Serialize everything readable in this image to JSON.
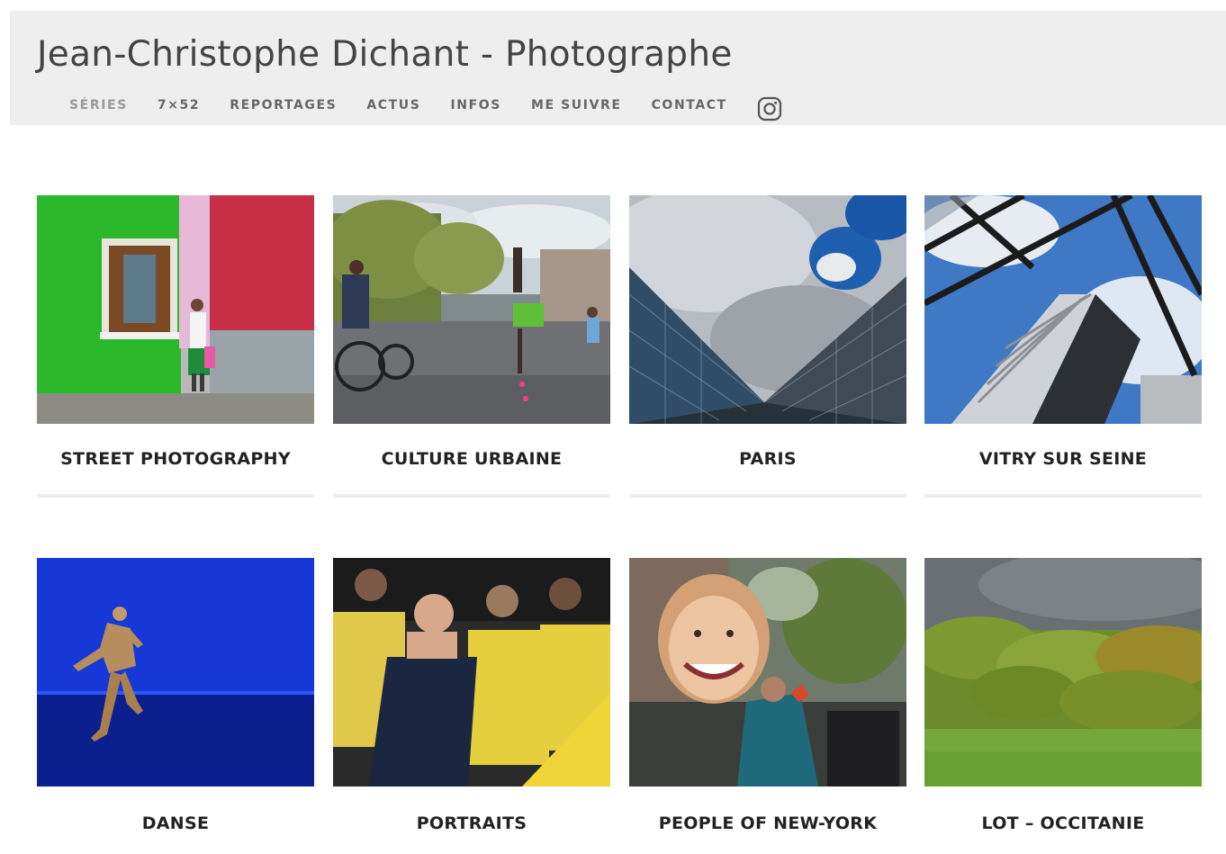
{
  "site": {
    "title": "Jean-Christophe Dichant - Photographe"
  },
  "nav": {
    "items": [
      {
        "label": "SÉRIES",
        "active": true
      },
      {
        "label": "7×52"
      },
      {
        "label": "REPORTAGES"
      },
      {
        "label": "ACTUS"
      },
      {
        "label": "INFOS"
      },
      {
        "label": "ME SUIVRE"
      },
      {
        "label": "CONTACT"
      }
    ],
    "instagram_icon": "instagram-icon"
  },
  "gallery": {
    "items": [
      {
        "title": "STREET PHOTOGRAPHY"
      },
      {
        "title": "CULTURE URBAINE"
      },
      {
        "title": "PARIS"
      },
      {
        "title": "VITRY SUR SEINE"
      },
      {
        "title": "DANSE"
      },
      {
        "title": "PORTRAITS"
      },
      {
        "title": "PEOPLE OF NEW-YORK"
      },
      {
        "title": "LOT – OCCITANIE"
      }
    ]
  }
}
